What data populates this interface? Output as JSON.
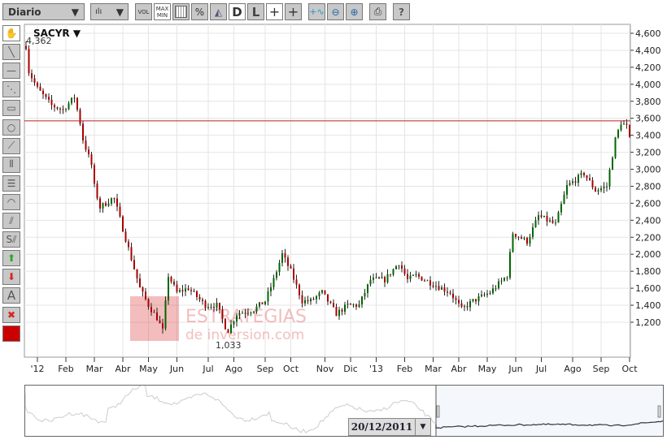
{
  "toolbar": {
    "period": "Diario",
    "buttons": [
      "VOL",
      "MAX MIN",
      "grid",
      "%",
      "area",
      "D",
      "L",
      "crosshair",
      "crosshair-L",
      "add-indicator",
      "zoom-out",
      "zoom-in",
      "print",
      "?"
    ],
    "vol": "VOL",
    "max": "MAX",
    "min": "MIN",
    "pct": "%",
    "d": "D",
    "l": "L",
    "help": "?"
  },
  "side_tools": [
    "hand",
    "line",
    "horizontal-line",
    "parallel-lines",
    "rectangle",
    "circle",
    "fan",
    "vertical-grid",
    "horizontal-grid",
    "arc",
    "channel",
    "s-channel",
    "buy-arrow",
    "sell-arrow",
    "text",
    "delete",
    "color"
  ],
  "side_text": "A",
  "watermark": {
    "line1": "ESTRATEGIAS",
    "line2": "de inversion.com"
  },
  "navigator": {
    "date": "20/12/2011"
  },
  "chart_data": {
    "type": "candlestick",
    "title": "SACYR ▼",
    "max_label": "4,362",
    "min_label": "1,033",
    "reference_line": 3570,
    "ylim": [
      1000,
      4700
    ],
    "yticks": [
      1200,
      1400,
      1600,
      1800,
      2000,
      2200,
      2400,
      2600,
      2800,
      3000,
      3200,
      3400,
      3600,
      3800,
      4000,
      4200,
      4400,
      4600
    ],
    "ytick_labels": [
      "1,200",
      "1,400",
      "1,600",
      "1,800",
      "2,000",
      "2,200",
      "2,400",
      "2,600",
      "2,800",
      "3,000",
      "3,200",
      "3,400",
      "3,600",
      "3,800",
      "4,000",
      "4,200",
      "4,400",
      "4,600"
    ],
    "xtick_labels": [
      "'12",
      "Feb",
      "Mar",
      "Abr",
      "May",
      "Jun",
      "Jul",
      "Ago",
      "Sep",
      "Oct",
      "Nov",
      "Dic",
      "'13",
      "Feb",
      "Mar",
      "Abr",
      "May",
      "Jun",
      "Jul",
      "Ago",
      "Sep",
      "Oct"
    ],
    "xtick_days": [
      4,
      14,
      24,
      34,
      43,
      53,
      64,
      73,
      84,
      93,
      105,
      114,
      123,
      133,
      143,
      152,
      162,
      172,
      181,
      192,
      202,
      212
    ],
    "keypoints": [
      [
        0,
        4450
      ],
      [
        1,
        4150
      ],
      [
        4,
        3950
      ],
      [
        9,
        3750
      ],
      [
        13,
        3700
      ],
      [
        17,
        3850
      ],
      [
        19,
        3550
      ],
      [
        20,
        3350
      ],
      [
        23,
        3050
      ],
      [
        24,
        2800
      ],
      [
        26,
        2550
      ],
      [
        30,
        2650
      ],
      [
        31,
        2650
      ],
      [
        34,
        2300
      ],
      [
        37,
        1950
      ],
      [
        40,
        1600
      ],
      [
        43,
        1400
      ],
      [
        46,
        1250
      ],
      [
        48,
        1100
      ],
      [
        50,
        1750
      ],
      [
        53,
        1550
      ],
      [
        57,
        1600
      ],
      [
        63,
        1400
      ],
      [
        67,
        1400
      ],
      [
        70,
        1150
      ],
      [
        71,
        1100
      ],
      [
        74,
        1300
      ],
      [
        80,
        1350
      ],
      [
        84,
        1450
      ],
      [
        87,
        1700
      ],
      [
        90,
        2000
      ],
      [
        93,
        1800
      ],
      [
        97,
        1450
      ],
      [
        100,
        1450
      ],
      [
        104,
        1550
      ],
      [
        109,
        1300
      ],
      [
        113,
        1400
      ],
      [
        117,
        1400
      ],
      [
        121,
        1700
      ],
      [
        126,
        1700
      ],
      [
        131,
        1900
      ],
      [
        134,
        1700
      ],
      [
        137,
        1750
      ],
      [
        143,
        1650
      ],
      [
        149,
        1550
      ],
      [
        153,
        1350
      ],
      [
        157,
        1450
      ],
      [
        163,
        1550
      ],
      [
        169,
        1750
      ],
      [
        171,
        2250
      ],
      [
        176,
        2150
      ],
      [
        180,
        2450
      ],
      [
        186,
        2350
      ],
      [
        190,
        2800
      ],
      [
        196,
        2950
      ],
      [
        200,
        2750
      ],
      [
        204,
        2800
      ],
      [
        207,
        3350
      ],
      [
        209,
        3550
      ],
      [
        211,
        3500
      ],
      [
        212,
        3350
      ]
    ]
  }
}
